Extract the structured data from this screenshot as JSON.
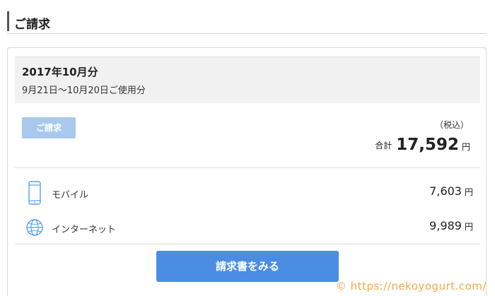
{
  "section": {
    "title": "ご請求"
  },
  "billing": {
    "period_label": "2017年10月分",
    "usage_range": "9月21日〜10月20日ご使用分",
    "badge_label": "ご請求",
    "tax_note": "（税込）",
    "total_label": "合計",
    "total_amount": "17,592",
    "currency": "円"
  },
  "items": [
    {
      "icon": "mobile-phone-icon",
      "label": "モバイル",
      "amount": "7,603",
      "currency": "円"
    },
    {
      "icon": "globe-icon",
      "label": "インターネット",
      "amount": "9,989",
      "currency": "円"
    }
  ],
  "actions": {
    "view_invoice_label": "請求書をみる"
  },
  "watermark": "© https://nekoyogurt.com/",
  "colors": {
    "accent": "#4a8de3",
    "badge": "#a9c8ee",
    "icon": "#5aa0e6",
    "watermark": "#f0a94a"
  }
}
